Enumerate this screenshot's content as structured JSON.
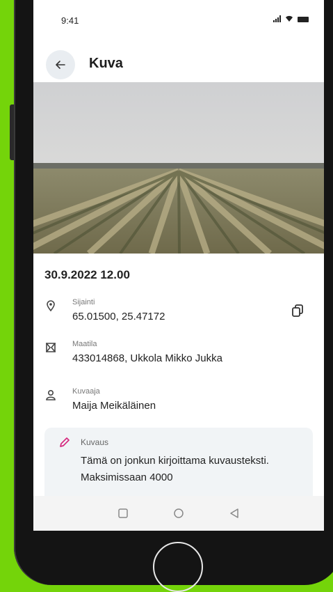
{
  "status": {
    "time": "9:41"
  },
  "header": {
    "title": "Kuva"
  },
  "photo": {
    "subject": "field-photo"
  },
  "detail": {
    "datetime": "30.9.2022 12.00",
    "location": {
      "label": "Sijainti",
      "value": "65.01500, 25.47172"
    },
    "farm": {
      "label": "Maatila",
      "value": "433014868, Ukkola Mikko Jukka"
    },
    "photographer": {
      "label": "Kuvaaja",
      "value": "Maija Meikäläinen"
    },
    "description": {
      "label": "Kuvaus",
      "value": "Tämä on jonkun kirjoittama kuvausteksti. Maksimissaan 4000"
    }
  },
  "colors": {
    "background": "#74d40a",
    "accent_icon": "#d6297e"
  },
  "icons": [
    "back-arrow-icon",
    "location-pin-icon",
    "copy-icon",
    "farm-map-icon",
    "person-icon",
    "pencil-icon",
    "square-icon",
    "circle-icon",
    "triangle-back-icon"
  ]
}
